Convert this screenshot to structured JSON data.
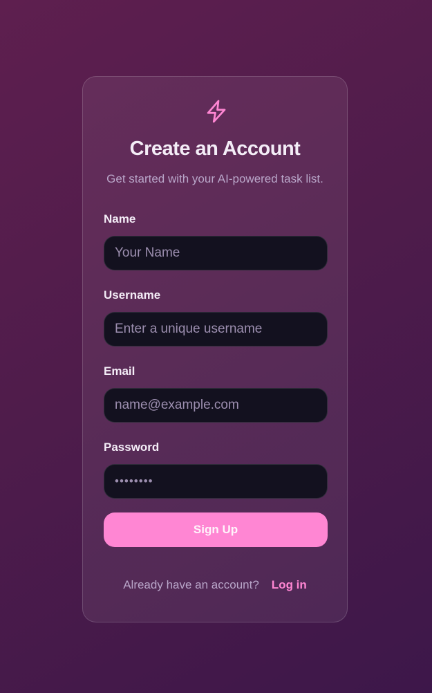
{
  "header": {
    "logo_icon": "lightning-bolt-icon",
    "title": "Create an Account",
    "subtitle": "Get started with your AI-powered task list."
  },
  "form": {
    "name": {
      "label": "Name",
      "placeholder": "Your Name",
      "value": ""
    },
    "username": {
      "label": "Username",
      "placeholder": "Enter a unique username",
      "value": ""
    },
    "email": {
      "label": "Email",
      "placeholder": "name@example.com",
      "value": ""
    },
    "password": {
      "label": "Password",
      "placeholder": "••••••••",
      "value": ""
    },
    "submit_label": "Sign Up"
  },
  "footer": {
    "prompt": "Already have an account?",
    "login_label": "Log in"
  },
  "colors": {
    "accent": "#ff86d3",
    "input_bg": "#13111f",
    "background": "#4f1c4b"
  }
}
